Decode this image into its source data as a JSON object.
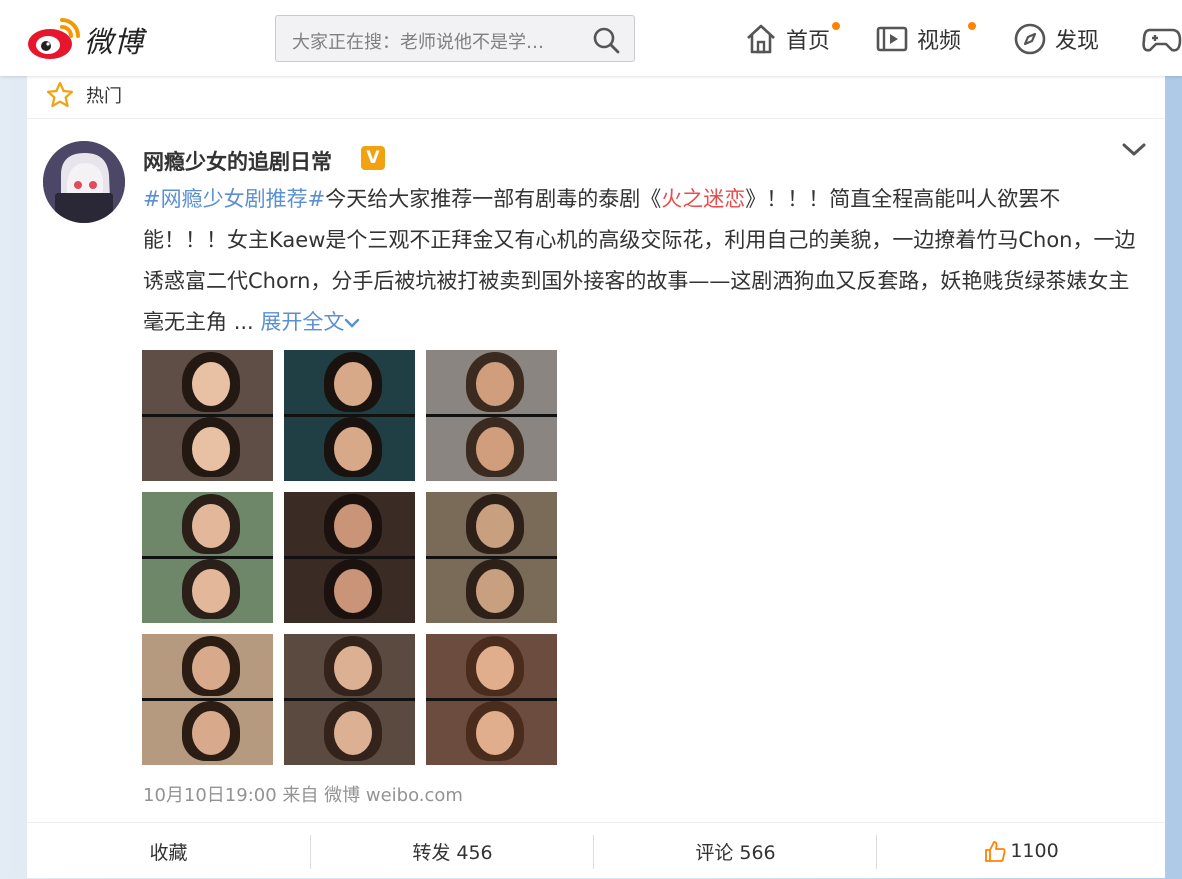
{
  "header": {
    "logo_text": "微博",
    "search_placeholder": "大家正在搜：老师说他不是学…",
    "nav": [
      {
        "label": "首页",
        "icon": "home-icon",
        "badge": true
      },
      {
        "label": "视频",
        "icon": "video-icon",
        "badge": true
      },
      {
        "label": "发现",
        "icon": "compass-icon",
        "badge": false
      }
    ]
  },
  "section": {
    "label": "热门"
  },
  "post": {
    "username": "网瘾少女的追剧日常",
    "verified_badge": "V",
    "content": {
      "topic": "#网瘾少女剧推荐#",
      "text_before": "今天给大家推荐一部有剧毒的泰剧《",
      "drama": "火之迷恋",
      "text_after": "》！！！简直全程高能叫人欲罢不能！！！女主Kaew是个三观不正拜金又有心机的高级交际花，利用自己的美貌，一边撩着竹马Chon，一边诱惑富二代Chorn，分手后被坑被打被卖到国外接客的故事——这剧洒狗血又反套路，妖艳贱货绿茶婊女主毫无主角 ",
      "ellipsis": "...",
      "expand": "展开全文"
    },
    "images": [
      {
        "alt": "剧照1",
        "bg": "#5e4e45",
        "face": "#e8c1a5",
        "hair": "#241812"
      },
      {
        "alt": "剧照2",
        "bg": "#1f3f44",
        "face": "#d7a989",
        "hair": "#1a120e"
      },
      {
        "alt": "剧照3",
        "bg": "#8a8580",
        "face": "#d09e7c",
        "hair": "#3b2a1f"
      },
      {
        "alt": "剧照4",
        "bg": "#6f8769",
        "face": "#e3b89a",
        "hair": "#2b1f19"
      },
      {
        "alt": "剧照5",
        "bg": "#3b2b25",
        "face": "#c99478",
        "hair": "#1b120f"
      },
      {
        "alt": "剧照6",
        "bg": "#7a6a58",
        "face": "#c9a07f",
        "hair": "#2d2019"
      },
      {
        "alt": "剧照7",
        "bg": "#b59a80",
        "face": "#d9a98c",
        "hair": "#2b1c14"
      },
      {
        "alt": "剧照8",
        "bg": "#5a4a40",
        "face": "#dcb093",
        "hair": "#33231b"
      },
      {
        "alt": "剧照9",
        "bg": "#6b4c3e",
        "face": "#e0ae8c",
        "hair": "#4a2c1d"
      }
    ],
    "meta": "10月10日19:00 来自 微博 weibo.com",
    "actions": {
      "favorite": "收藏",
      "repost": "转发 456",
      "comment": "评论 566",
      "like": "1100"
    }
  },
  "colors": {
    "link": "#5a8fd0",
    "highlight": "#eb4b4b",
    "brand_orange": "#ff8200",
    "verified": "#f0a210"
  }
}
